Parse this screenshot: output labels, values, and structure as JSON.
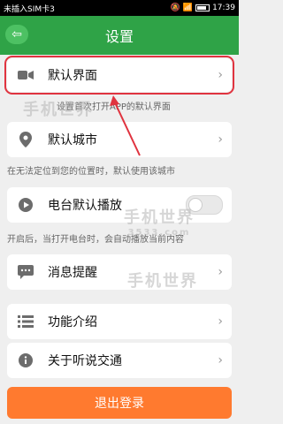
{
  "statusbar": {
    "carrier": "未插入SIM卡3",
    "time": "17:39"
  },
  "header": {
    "title": "设置"
  },
  "items": [
    {
      "label": "默认界面",
      "note": "设置首次打开APP的默认界面"
    },
    {
      "label": "默认城市",
      "note": "在无法定位到您的位置时，默认使用该城市"
    },
    {
      "label": "电台默认播放",
      "note": "开启后，当打开电台时，会自动播放当前内容"
    },
    {
      "label": "消息提醒"
    },
    {
      "label": "功能介绍"
    },
    {
      "label": "关于听说交通"
    }
  ],
  "logout": {
    "label": "退出登录"
  },
  "watermark": {
    "text1": "手机世界",
    "text2": "3533.com"
  },
  "colors": {
    "header": "#2fa347",
    "logout": "#ff7a2f",
    "highlight": "#e0333f"
  }
}
